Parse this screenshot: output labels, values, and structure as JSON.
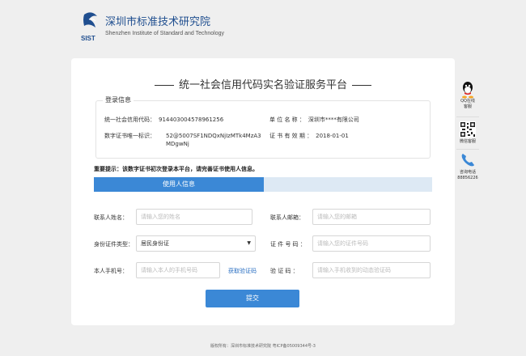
{
  "header": {
    "logo_text": "SIST",
    "name_cn": "深圳市标准技术研究院",
    "name_en": "Shenzhen Institute of Standard and Technology"
  },
  "page": {
    "title": "统一社会信用代码实名验证服务平台"
  },
  "login_info": {
    "legend": "登录信息",
    "credit_code_label": "统一社会信用代码：",
    "credit_code_value": "914403004578961256",
    "unit_name_label": "单 位 名 称 ：",
    "unit_name_value": "深圳市****有限公司",
    "cert_id_label": "数字证书唯一标识：",
    "cert_id_value": "52@5007SF1NDQxNjIzMTk4MzA3MDgwNj",
    "cert_valid_label": "证 书 有 效 期 ：",
    "cert_valid_value": "2018-01-01"
  },
  "notice": "重要提示：该数字证书初次登录本平台，请完善证书使用人信息。",
  "tabs": {
    "active": "使用人信息"
  },
  "form": {
    "name_label": "联系人姓名：",
    "name_placeholder": "请输入您的姓名",
    "email_label": "联系人邮箱：",
    "email_placeholder": "请输入您的邮箱",
    "id_type_label": "身份证件类型：",
    "id_type_value": "居民身份证",
    "id_number_label": "证 件 号 码 ：",
    "id_number_placeholder": "请输入您的证件号码",
    "phone_label": "本人手机号：",
    "phone_placeholder": "请输入本人的手机号码",
    "sms_link": "获取验证码",
    "code_label": "验 证 码 ：",
    "code_placeholder": "请输入手机收到的动态验证码",
    "submit": "提交"
  },
  "sidebar": {
    "qq_label": "QQ在线",
    "qq_sub": "客服",
    "wechat_label": "微信客服",
    "phone_label": "咨询电话",
    "phone_number": "88856226"
  },
  "footer": "版权所有：深圳市标准技术研究院   粤ICP备05009344号-3",
  "colors": {
    "primary": "#3b88d6",
    "tab_bg": "#dde9f4",
    "brand": "#1f4e8f"
  }
}
